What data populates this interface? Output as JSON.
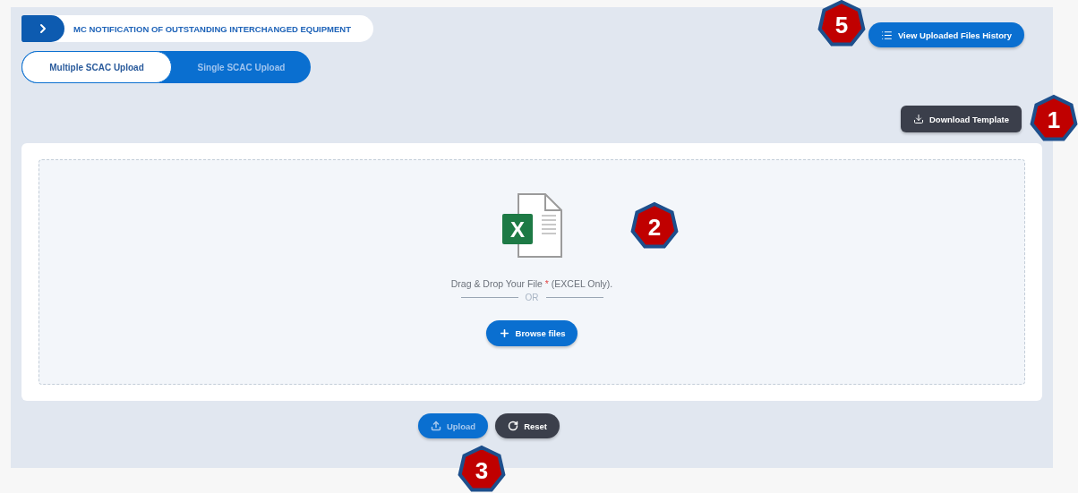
{
  "header": {
    "title": "MC NOTIFICATION OF OUTSTANDING INTERCHANGED EQUIPMENT"
  },
  "history_button": {
    "label": "View Uploaded Files History",
    "callout": "5"
  },
  "tabs": [
    {
      "label": "Multiple SCAC Upload",
      "selected": true
    },
    {
      "label": "Single SCAC Upload",
      "selected": false
    }
  ],
  "download_button": {
    "label": "Download Template",
    "callout": "1"
  },
  "dropzone": {
    "file_letter": "X",
    "prompt": "Drag & Drop Your File",
    "required_mark": "*",
    "note": "(EXCEL Only).",
    "separator": "OR",
    "callout": "2",
    "browse_button": {
      "label": "Browse files"
    }
  },
  "actions": [
    {
      "kind": "upload",
      "label": "Upload",
      "disabled": true,
      "callout": "3"
    },
    {
      "kind": "reset",
      "label": "Reset",
      "disabled": false
    }
  ]
}
